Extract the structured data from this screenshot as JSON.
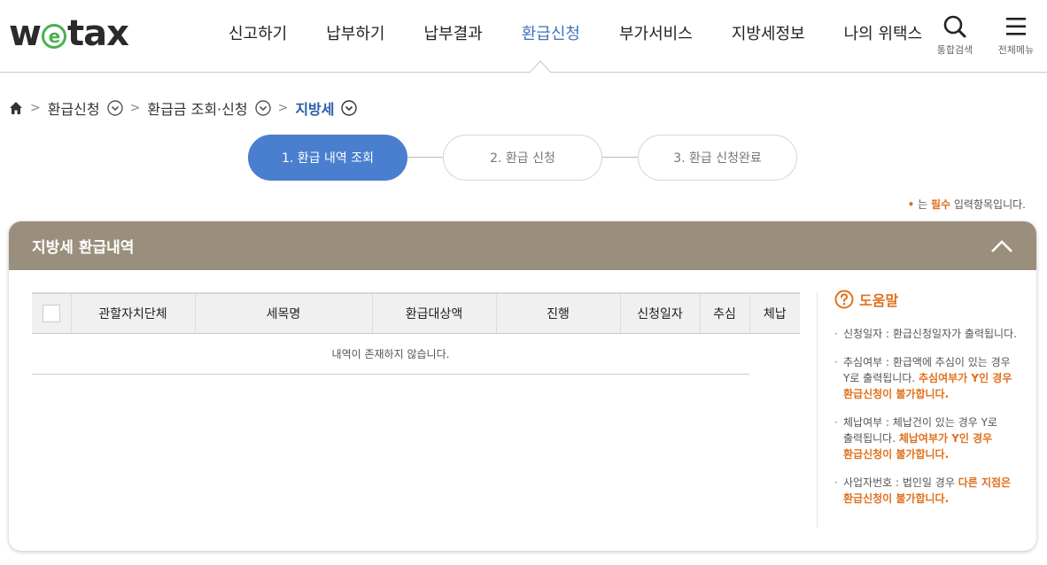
{
  "header": {
    "logo_text": "wetax",
    "nav": [
      "신고하기",
      "납부하기",
      "납부결과",
      "환급신청",
      "부가서비스",
      "지방세정보",
      "나의 위택스"
    ],
    "active_index": 3,
    "search_label": "통합검색",
    "menu_label": "전체메뉴"
  },
  "breadcrumb": {
    "items": [
      "환급신청",
      "환급금 조회·신청",
      "지방세"
    ]
  },
  "steps": [
    "1. 환급 내역 조회",
    "2. 환급 신청",
    "3. 환급 신청완료"
  ],
  "active_step": 0,
  "required_note": {
    "mark": "•",
    "prefix": " 는 ",
    "strong": "필수",
    "suffix": " 입력항목입니다."
  },
  "panel": {
    "title": "지방세 환급내역",
    "table": {
      "columns": [
        "관할자치단체",
        "세목명",
        "환급대상액",
        "진행",
        "신청일자",
        "추심",
        "체납"
      ],
      "empty_message": "내역이 존재하지 않습니다."
    },
    "help": {
      "title": "도움말",
      "items": [
        {
          "text": "신청일자 : 환급신청일자가 출력됩니다.",
          "warn": ""
        },
        {
          "text": "추심여부 : 환급액에 추심이 있는 경우 Y로 출력됩니다. ",
          "warn": "추심여부가 Y인 경우 환급신청이 불가합니다."
        },
        {
          "text": "체납여부 : 체납건이 있는 경우 Y로 출력됩니다. ",
          "warn": "체납여부가 Y인 경우 환급신청이 불가합니다."
        },
        {
          "text": "사업자번호 : 법인일 경우 ",
          "warn": "다른 지점은 환급신청이 불가합니다."
        }
      ]
    }
  },
  "colors": {
    "accent": "#4a7fcf",
    "active_nav": "#3d73b8",
    "panel_header": "#9a8f7d",
    "warning": "#e0701f",
    "logo_e": "#4caf50"
  }
}
